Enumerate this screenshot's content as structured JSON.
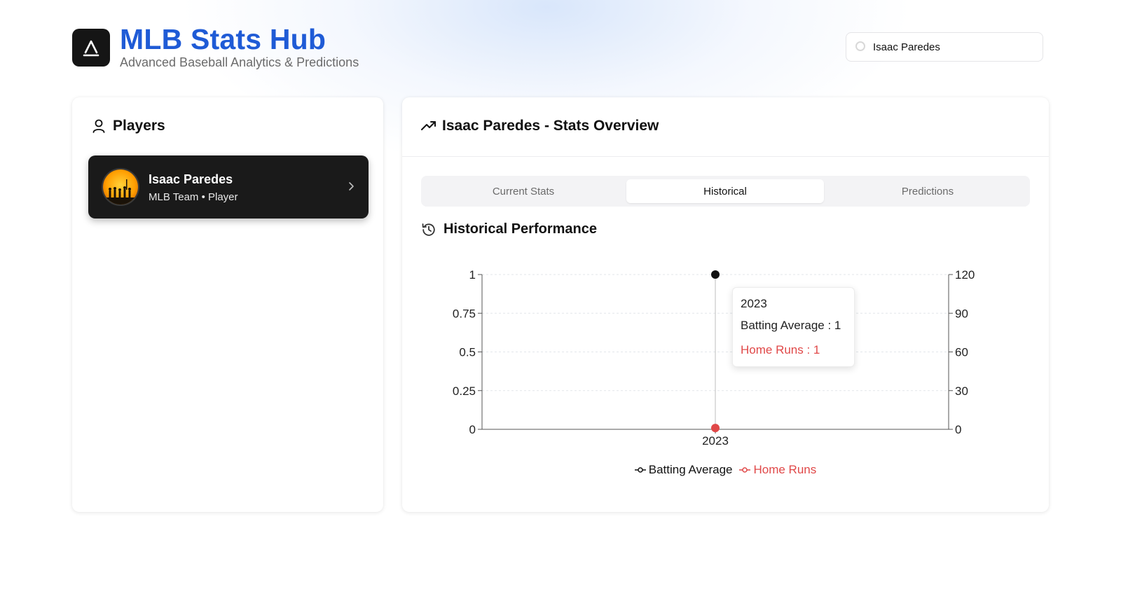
{
  "app": {
    "title": "MLB Stats Hub",
    "subtitle": "Advanced Baseball Analytics & Predictions"
  },
  "search": {
    "value": "Isaac Paredes"
  },
  "players_panel": {
    "title": "Players",
    "players": [
      {
        "name": "Isaac Paredes",
        "meta": "MLB Team • Player"
      }
    ]
  },
  "stats_panel": {
    "title": "Isaac Paredes - Stats Overview",
    "tabs": [
      {
        "label": "Current Stats",
        "active": false
      },
      {
        "label": "Historical",
        "active": true
      },
      {
        "label": "Predictions",
        "active": false
      }
    ],
    "section_title": "Historical Performance"
  },
  "tooltip": {
    "year": "2023",
    "line1": "Batting Average : 1",
    "line2": "Home Runs : 1"
  },
  "colors": {
    "accent": "#1f5bd6",
    "batting_average": "#111111",
    "home_runs": "#e04848"
  },
  "chart_data": {
    "type": "line",
    "x": [
      "2023"
    ],
    "series": [
      {
        "name": "Batting Average",
        "axis": "left",
        "values": [
          1
        ],
        "color": "#111111"
      },
      {
        "name": "Home Runs",
        "axis": "right",
        "values": [
          1
        ],
        "color": "#e04848"
      }
    ],
    "left_axis": {
      "ticks": [
        "0",
        "0.25",
        "0.5",
        "0.75",
        "1"
      ],
      "ylim": [
        0,
        1
      ]
    },
    "right_axis": {
      "ticks": [
        "0",
        "30",
        "60",
        "90",
        "120"
      ],
      "ylim": [
        0,
        120
      ]
    },
    "grid": true,
    "legend": "bottom"
  }
}
